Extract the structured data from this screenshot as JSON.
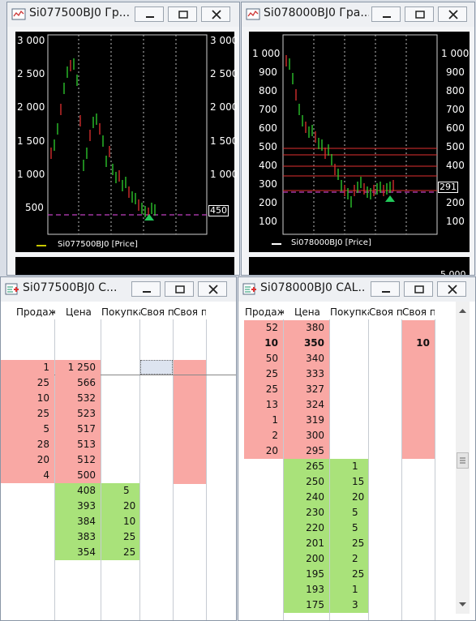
{
  "windows": {
    "chart1": {
      "title": "Si077500BJ0 Гр...",
      "legend": "Si077500BJ0 [Price]",
      "price_label": "450",
      "y_ticks": [
        "3 000",
        "2 500",
        "2 000",
        "1 500",
        "1 000",
        "500"
      ]
    },
    "chart2": {
      "title": "Si078000BJ0 Гра...",
      "legend": "Si078000BJ0 [Price]",
      "price_label": "291",
      "y_ticks": [
        "1 000",
        "900",
        "800",
        "700",
        "600",
        "500",
        "400",
        "300",
        "200",
        "100"
      ],
      "peek_label": "5 000"
    },
    "book1": {
      "title": "Si077500BJ0 C...",
      "headers": [
        "Продаж",
        "Цена",
        "Покупка",
        "Своя п",
        "Своя п"
      ],
      "sell_rows": [
        {
          "qty": "1",
          "price": "1 250"
        },
        {
          "qty": "25",
          "price": "566"
        },
        {
          "qty": "10",
          "price": "532"
        },
        {
          "qty": "25",
          "price": "523"
        },
        {
          "qty": "5",
          "price": "517"
        },
        {
          "qty": "28",
          "price": "513"
        },
        {
          "qty": "20",
          "price": "512"
        },
        {
          "qty": "4",
          "price": "500"
        }
      ],
      "buy_rows": [
        {
          "price": "408",
          "qty": "5"
        },
        {
          "price": "393",
          "qty": "20"
        },
        {
          "price": "384",
          "qty": "10"
        },
        {
          "price": "383",
          "qty": "25"
        },
        {
          "price": "354",
          "qty": "25"
        }
      ]
    },
    "book2": {
      "title": "Si078000BJ0 CAL...",
      "headers": [
        "Продаж",
        "Цена",
        "Покупка",
        "Своя п",
        "Своя п"
      ],
      "sell_rows": [
        {
          "qty": "52",
          "price": "380"
        },
        {
          "qty": "10",
          "price": "350",
          "own": "10"
        },
        {
          "qty": "50",
          "price": "340"
        },
        {
          "qty": "25",
          "price": "333"
        },
        {
          "qty": "25",
          "price": "327"
        },
        {
          "qty": "13",
          "price": "324"
        },
        {
          "qty": "1",
          "price": "319"
        },
        {
          "qty": "2",
          "price": "300"
        },
        {
          "qty": "20",
          "price": "295"
        }
      ],
      "buy_rows": [
        {
          "price": "265",
          "qty": "1"
        },
        {
          "price": "250",
          "qty": "15"
        },
        {
          "price": "240",
          "qty": "20"
        },
        {
          "price": "230",
          "qty": "5"
        },
        {
          "price": "220",
          "qty": "5"
        },
        {
          "price": "201",
          "qty": "25"
        },
        {
          "price": "200",
          "qty": "2"
        },
        {
          "price": "195",
          "qty": "25"
        },
        {
          "price": "193",
          "qty": "1"
        },
        {
          "price": "175",
          "qty": "3"
        }
      ]
    }
  },
  "colors": {
    "sell_bg": "#f9a8a4",
    "buy_bg": "#a9e27a",
    "chart_bg": "#000000",
    "dashed_level": "#c040c0",
    "resistance": "#e03030",
    "arrow": "#22c95a"
  }
}
